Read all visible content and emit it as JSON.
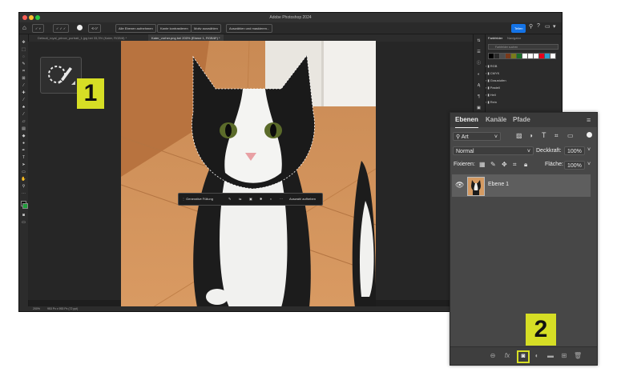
{
  "app": {
    "title": "Adobe Photoshop 2024",
    "options_bar": {
      "all_layers_label": "Alle Ebenen aufnehmen",
      "edge_contrast_label": "Kante kontrastieren",
      "subject_label": "Motiv auswählen",
      "select_mask_label": "Auswählen und maskieren..."
    },
    "share_label": "Teilen",
    "tabs": [
      {
        "label": "Default_royal_prince_portrait_1.jpg bei 33,3% (Kater, RGB/8) *"
      },
      {
        "label": "Kater_vorher.png bei 200% (Ebene 1, RGB/8*) *"
      }
    ],
    "status": {
      "zoom": "200%",
      "size": "953 Px x 953 Px (72 ppi)"
    }
  },
  "swatches_panel": {
    "tabs": [
      "Farbfelder",
      "Navigator"
    ],
    "search_placeholder": "Farbfelder suchen",
    "folders": [
      "RGB",
      "CMYK",
      "Graustufen",
      "Pastell",
      "Hell",
      "Rein"
    ],
    "colors": [
      "#000000",
      "#2a2a2a",
      "#4d4d4d",
      "#7a3a1a",
      "#7b7b1a",
      "#1a6e2a",
      "#ffffff",
      "#ffffff",
      "#ffffff",
      "#e8001c",
      "#2aa0d0",
      "#ffffff"
    ]
  },
  "callouts": {
    "badge_1": "1",
    "badge_2": "2"
  },
  "context_bar": {
    "generative_fill": "Generative Füllung",
    "deselect": "Auswahl aufheben"
  },
  "layers_panel": {
    "tabs": [
      "Ebenen",
      "Kanäle",
      "Pfade"
    ],
    "filter_kind": "Art",
    "blend_mode": "Normal",
    "opacity_label": "Deckkraft:",
    "opacity_value": "100%",
    "lock_label": "Fixieren:",
    "fill_label": "Fläche:",
    "fill_value": "100%",
    "layer_name": "Ebene 1",
    "bottom_fx": "fx"
  },
  "colors": {
    "accent_badge": "#d6de25",
    "share_button": "#1473e6",
    "panel_bg": "#474747"
  }
}
